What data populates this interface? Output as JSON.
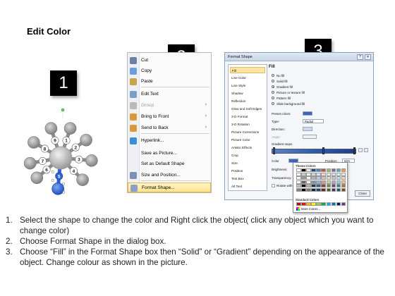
{
  "title": "Edit Color",
  "steps": [
    "1",
    "2",
    "3"
  ],
  "diagram": {
    "node_numbers": [
      "9",
      "1",
      "8",
      "2",
      "7",
      "3",
      "6",
      "5",
      "4"
    ]
  },
  "context_menu": {
    "items": [
      {
        "label": "Cut",
        "icon": "scissors-icon"
      },
      {
        "label": "Copy",
        "icon": "copy-icon"
      },
      {
        "label": "Paste",
        "icon": "paste-icon"
      },
      {
        "label": "Edit Text",
        "icon": "edit-text-icon"
      },
      {
        "label": "Group",
        "icon": "group-icon",
        "disabled": true,
        "submenu": true
      },
      {
        "label": "Bring to Front",
        "icon": "bring-front-icon",
        "submenu": true
      },
      {
        "label": "Send to Back",
        "icon": "send-back-icon",
        "submenu": true
      },
      {
        "label": "Hyperlink...",
        "icon": "globe-icon"
      },
      {
        "label": "Save as Picture...",
        "icon": ""
      },
      {
        "label": "Set as Default Shape",
        "icon": ""
      },
      {
        "label": "Size and Position...",
        "icon": "size-icon"
      },
      {
        "label": "Format Shape...",
        "icon": "format-shape-icon",
        "highlighted": true
      }
    ]
  },
  "format_dialog": {
    "title": "Format Shape",
    "nav": [
      "Fill",
      "Line Color",
      "Line Style",
      "Shadow",
      "Reflection",
      "Glow and Soft Edges",
      "3-D Format",
      "3-D Rotation",
      "Picture Corrections",
      "Picture Color",
      "Artistic Effects",
      "Crop",
      "Size",
      "Position",
      "Text Box",
      "Alt Text"
    ],
    "section": "Fill",
    "fill_options": [
      "No fill",
      "Solid fill",
      "Gradient fill",
      "Picture or texture fill",
      "Pattern fill",
      "Slide background fill"
    ],
    "selected_fill": "Gradient fill",
    "preset_label": "Preset colors:",
    "type_label": "Type:",
    "type_value": "Radial",
    "direction_label": "Direction:",
    "angle_label": "Angle:",
    "stops_label": "Gradient stops",
    "color_label": "Color",
    "position_label": "Position:",
    "position_value": "64%",
    "brightness_label": "Brightness:",
    "transparency_label": "Transparency:",
    "rotate_label": "Rotate with shape",
    "close_label": "Close"
  },
  "color_palette": {
    "theme_label": "Theme Colors",
    "standard_label": "Standard Colors",
    "more_label": "More Colors...",
    "theme_columns": [
      "#ffffff",
      "#000000",
      "#eeece1",
      "#1f497d",
      "#4f81bd",
      "#c0504d",
      "#9bbb59",
      "#8064a2",
      "#4bacc6",
      "#f79646"
    ],
    "standard": [
      "#c00000",
      "#ff0000",
      "#ffc000",
      "#ffff00",
      "#92d050",
      "#00b050",
      "#00b0f0",
      "#0070c0",
      "#002060",
      "#7030a0"
    ]
  },
  "instructions": [
    {
      "num": "1.",
      "text": "Select the shape to change the color and Right click the object( click any object which you want to change color)"
    },
    {
      "num": "2.",
      "text": "Choose Format Shape in the dialog box."
    },
    {
      "num": "3.",
      "text": "Choose “Fill” in the Format Shape box then “Solid” or “Gradient” depending on the appearance of the object. Change colour as shown in the picture."
    }
  ]
}
